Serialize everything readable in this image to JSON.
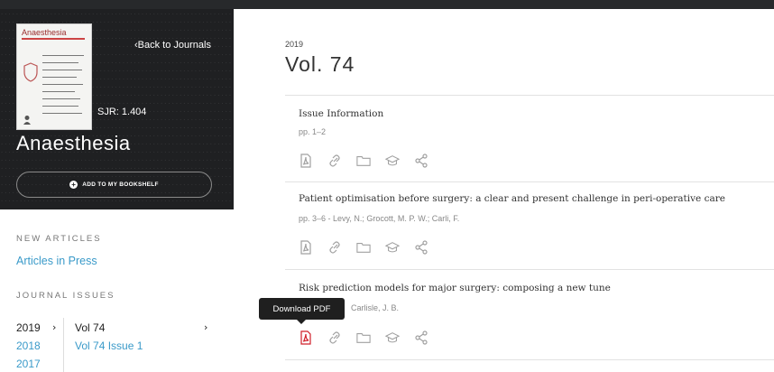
{
  "journal": {
    "cover_title": "Anaesthesia",
    "back_label": "Back to Journals",
    "sjr": "SJR: 1.404",
    "name": "Anaesthesia",
    "bookshelf_label": "ADD TO MY BOOKSHELF"
  },
  "sidebar": {
    "new_articles_label": "NEW ARTICLES",
    "articles_in_press": "Articles in Press",
    "journal_issues_label": "JOURNAL ISSUES",
    "years": [
      "2019",
      "2018",
      "2017"
    ],
    "volumes": [
      "Vol 74",
      "Vol 74 Issue 1"
    ]
  },
  "main": {
    "year": "2019",
    "volume": "Vol. 74",
    "articles": [
      {
        "title": "Issue Information",
        "meta": "pp. 1–2"
      },
      {
        "title": "Patient optimisation before surgery: a clear and present challenge in peri-operative care",
        "meta": "pp. 3–6  -  Levy, N.; Grocott, M. P. W.; Carli, F."
      },
      {
        "title": "Risk prediction models for major surgery: composing a new tune",
        "meta": "Carlisle, J. B."
      }
    ]
  },
  "tooltip": {
    "label": "Download PDF"
  },
  "colors": {
    "link": "#3a9ac9",
    "dark_panel": "#1f2022",
    "pdf_active": "#d0202a"
  }
}
